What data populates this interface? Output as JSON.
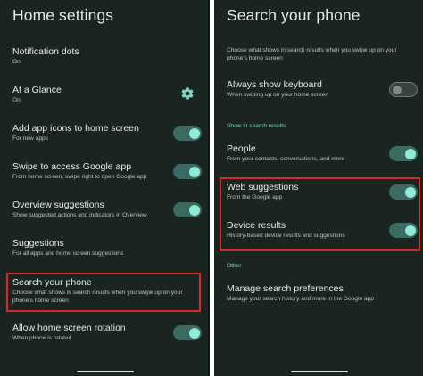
{
  "left": {
    "title": "Home settings",
    "items": [
      {
        "title": "Notification dots",
        "sub": "On"
      },
      {
        "title": "At a Glance",
        "sub": "On",
        "icon": "gear-icon"
      },
      {
        "title": "Add app icons to home screen",
        "sub": "For new apps",
        "toggle": "on"
      },
      {
        "title": "Swipe to access Google app",
        "sub": "From home screen, swipe right to open Google app",
        "toggle": "on"
      },
      {
        "title": "Overview suggestions",
        "sub": "Show suggested actions and indicators in Overview",
        "toggle": "on"
      },
      {
        "title": "Suggestions",
        "sub": "For all apps and home screen suggestions"
      },
      {
        "title": "Search your phone",
        "sub1": "Choose what shows in search results when you swipe up on your",
        "sub2": "phone's home screen"
      },
      {
        "title": "Allow home screen rotation",
        "sub": "When phone is rotated",
        "toggle": "on"
      }
    ]
  },
  "right": {
    "title": "Search your phone",
    "desc1": "Choose what shows in search results when you swipe up on your",
    "desc2": "phone's home screen",
    "always_keyboard": {
      "title": "Always show keyboard",
      "sub": "When swiping up on your home screen",
      "toggle": "off"
    },
    "section_label": "Show in search results",
    "people": {
      "title": "People",
      "sub": "From your contacts, conversations, and more",
      "toggle": "on"
    },
    "web": {
      "title": "Web suggestions",
      "sub": "From the Google app",
      "toggle": "on"
    },
    "device": {
      "title": "Device results",
      "sub": "History-based device results and suggestions",
      "toggle": "on"
    },
    "other_label": "Other",
    "manage": {
      "title": "Manage search preferences",
      "sub": "Manage your search history and more in the Google app"
    }
  },
  "colors": {
    "background": "#1a2420",
    "accent": "#8fecd6",
    "highlight": "#d42a2c"
  }
}
